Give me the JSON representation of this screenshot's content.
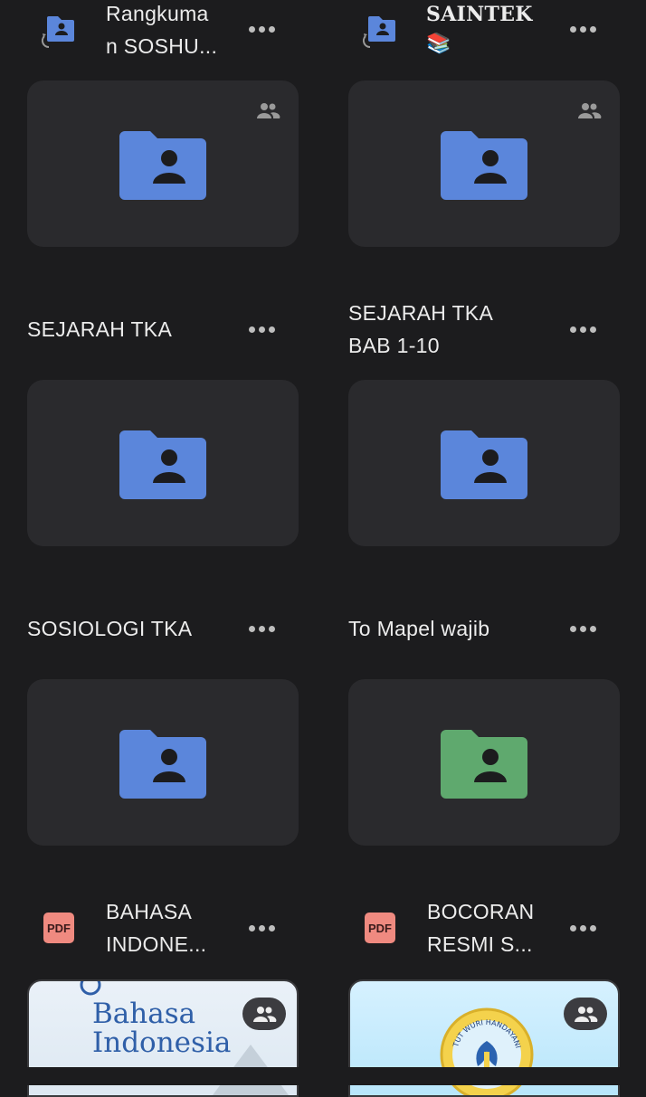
{
  "items": [
    {
      "title": "Rangkuma\nn SOSHU...",
      "type": "shortcut-folder",
      "color": "#5b86db"
    },
    {
      "title": "SAINTEK\n📚",
      "type": "shortcut-folder",
      "color": "#5b86db"
    },
    {
      "title": "SEJARAH TKA",
      "type": "shared-folder",
      "color": "#5b86db"
    },
    {
      "title": "SEJARAH TKA\nBAB 1-10",
      "type": "shared-folder",
      "color": "#5b86db"
    },
    {
      "title": "SOSIOLOGI TKA",
      "type": "shared-folder",
      "color": "#5b86db"
    },
    {
      "title": "To Mapel wajib",
      "type": "shared-folder",
      "color": "#5fa96e"
    },
    {
      "title": "BAHASA\nINDONE...",
      "type": "pdf",
      "badge": "PDF"
    },
    {
      "title": "BOCORAN\nRESMI S...",
      "type": "pdf",
      "badge": "PDF"
    }
  ],
  "thumbnails": {
    "bahasa": {
      "title": "Bahasa\nIndonesia"
    },
    "bocoran": {
      "emblem_text": "TUT WURI HANDAYANI"
    }
  },
  "colors": {
    "background": "#1c1c1e",
    "card": "#2a2a2d",
    "folder_blue": "#5b86db",
    "folder_green": "#5fa96e",
    "pdf_red": "#ef8a80"
  }
}
